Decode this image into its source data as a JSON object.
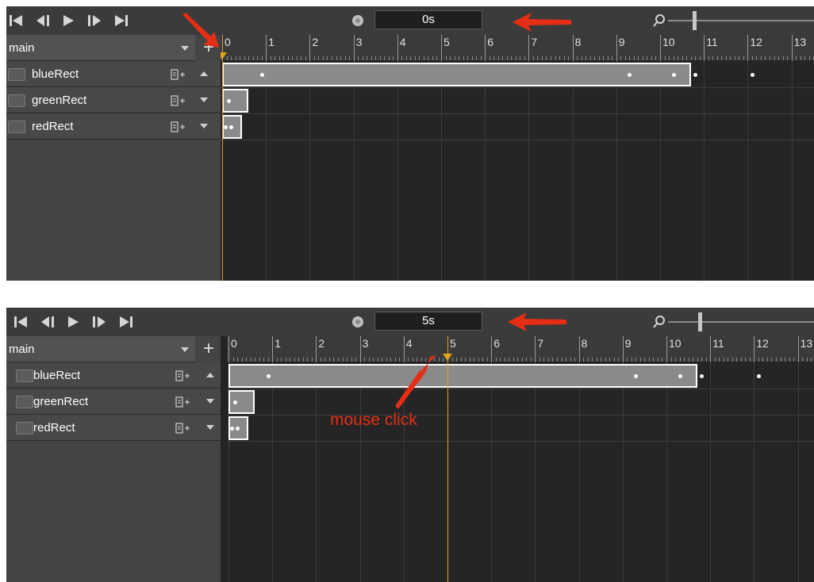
{
  "panels": [
    {
      "time_display": "0s",
      "playhead_seconds": 0,
      "scene": {
        "label": "main",
        "add_label": "+"
      },
      "tracks": [
        {
          "name": "blueRect",
          "expanded": true
        },
        {
          "name": "greenRect",
          "expanded": false
        },
        {
          "name": "redRect",
          "expanded": false
        }
      ]
    },
    {
      "time_display": "5s",
      "playhead_seconds": 5,
      "scene": {
        "label": "main",
        "add_label": "+"
      },
      "tracks": [
        {
          "name": "blueRect",
          "expanded": true
        },
        {
          "name": "greenRect",
          "expanded": false
        },
        {
          "name": "redRect",
          "expanded": false
        }
      ],
      "annotation": "mouse click"
    }
  ],
  "ruler_labels": [
    "0",
    "1",
    "2",
    "3",
    "4",
    "5",
    "6",
    "7",
    "8",
    "9",
    "10",
    "11",
    "12",
    "13"
  ],
  "clips": {
    "blueRect": {
      "start": 0,
      "end": 10.7,
      "keyframes": [
        0.9,
        9.3,
        10.3,
        10.8,
        12.1
      ]
    },
    "greenRect": {
      "start": 0,
      "end": 0.6,
      "keyframes": [
        0.15
      ]
    },
    "redRect": {
      "start": 0,
      "end": 0.45,
      "keyframes": [
        0.08,
        0.2
      ]
    }
  },
  "icons": {
    "transport": [
      "skip-to-start-icon",
      "step-back-icon",
      "play-icon",
      "step-forward-icon",
      "skip-to-end-icon"
    ],
    "record": "record-icon",
    "zoom": "magnifier-icon",
    "keyframe_add": "add-keyframe-icon"
  },
  "colors": {
    "playhead": "#e2a21a",
    "annotation": "#e52e14",
    "clip_fill": "#8a8a8a",
    "clip_border": "#ffffff"
  }
}
